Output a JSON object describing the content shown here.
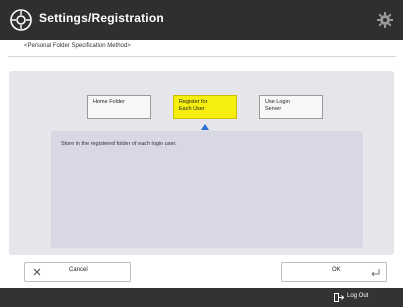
{
  "header": {
    "title": "Settings/Registration",
    "logo_icon": "settings-registration-icon",
    "gear_icon": "gear-icon"
  },
  "page": {
    "subtitle": "<Personal Folder Specification Method>"
  },
  "options": [
    {
      "line1": "Home Folder",
      "line2": "",
      "selected": false
    },
    {
      "line1": "Register for",
      "line2": "Each User",
      "selected": true
    },
    {
      "line1": "Use Login",
      "line2": "Server",
      "selected": false
    }
  ],
  "description": "Store in the registered folder of each login user.",
  "buttons": {
    "cancel": "Cancel",
    "ok": "OK"
  },
  "footer": {
    "logout": "Log Out"
  },
  "colors": {
    "selected": "#f5ee0f",
    "header": "#2f2f2f",
    "caret": "#2a6fd1"
  }
}
